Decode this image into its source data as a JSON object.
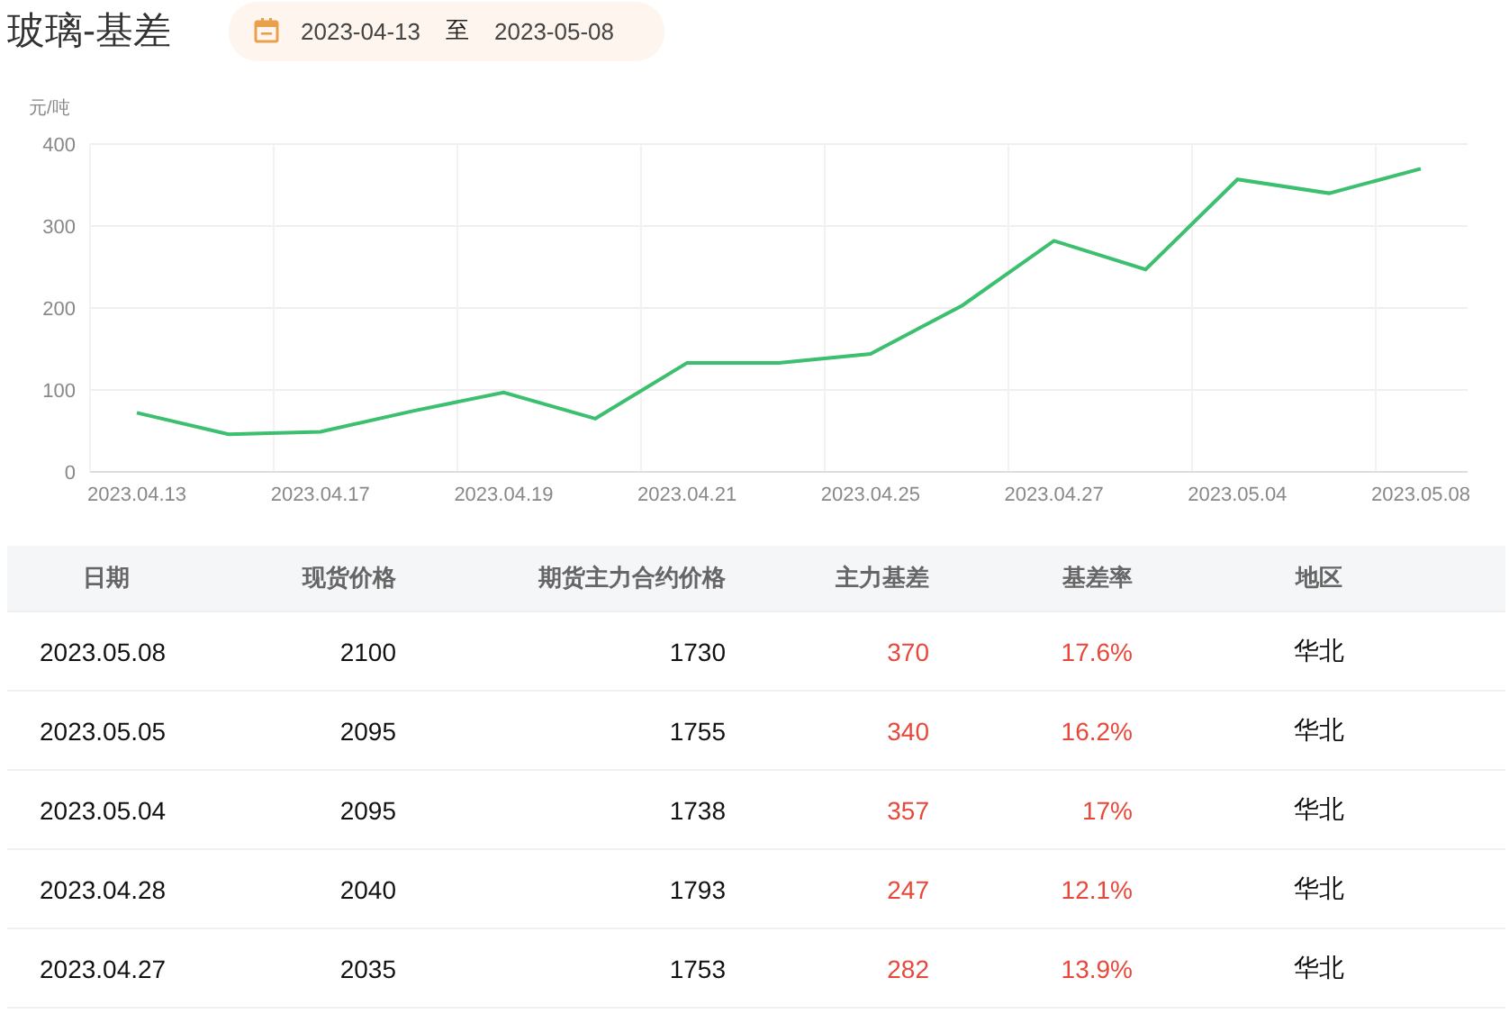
{
  "title": "玻璃-基差",
  "date_range": {
    "start": "2023-04-13",
    "separator": "至",
    "end": "2023-05-08"
  },
  "chart": {
    "chart_data": {
      "type": "line",
      "ylabel": "元/吨",
      "categories": [
        "2023.04.13",
        null,
        "2023.04.17",
        null,
        "2023.04.19",
        null,
        "2023.04.21",
        null,
        "2023.04.25",
        null,
        "2023.04.27",
        null,
        "2023.05.04",
        null,
        "2023.05.08"
      ],
      "grid": true,
      "ylim": [
        0,
        400
      ],
      "yticks": [
        0,
        100,
        200,
        300,
        400
      ],
      "series": [
        {
          "color": "#3cbf6f",
          "values": [
            72,
            46,
            49,
            74,
            97,
            65,
            133,
            133,
            144,
            203,
            282,
            247,
            357,
            340,
            370
          ]
        }
      ]
    }
  },
  "table": {
    "columns": [
      "日期",
      "现货价格",
      "期货主力合约价格",
      "主力基差",
      "基差率",
      "地区"
    ],
    "rows": [
      [
        "2023.05.08",
        "2100",
        "1730",
        "370",
        "17.6%",
        "华北"
      ],
      [
        "2023.05.05",
        "2095",
        "1755",
        "340",
        "16.2%",
        "华北"
      ],
      [
        "2023.05.04",
        "2095",
        "1738",
        "357",
        "17%",
        "华北"
      ],
      [
        "2023.04.28",
        "2040",
        "1793",
        "247",
        "12.1%",
        "华北"
      ],
      [
        "2023.04.27",
        "2035",
        "1753",
        "282",
        "13.9%",
        "华北"
      ]
    ]
  }
}
